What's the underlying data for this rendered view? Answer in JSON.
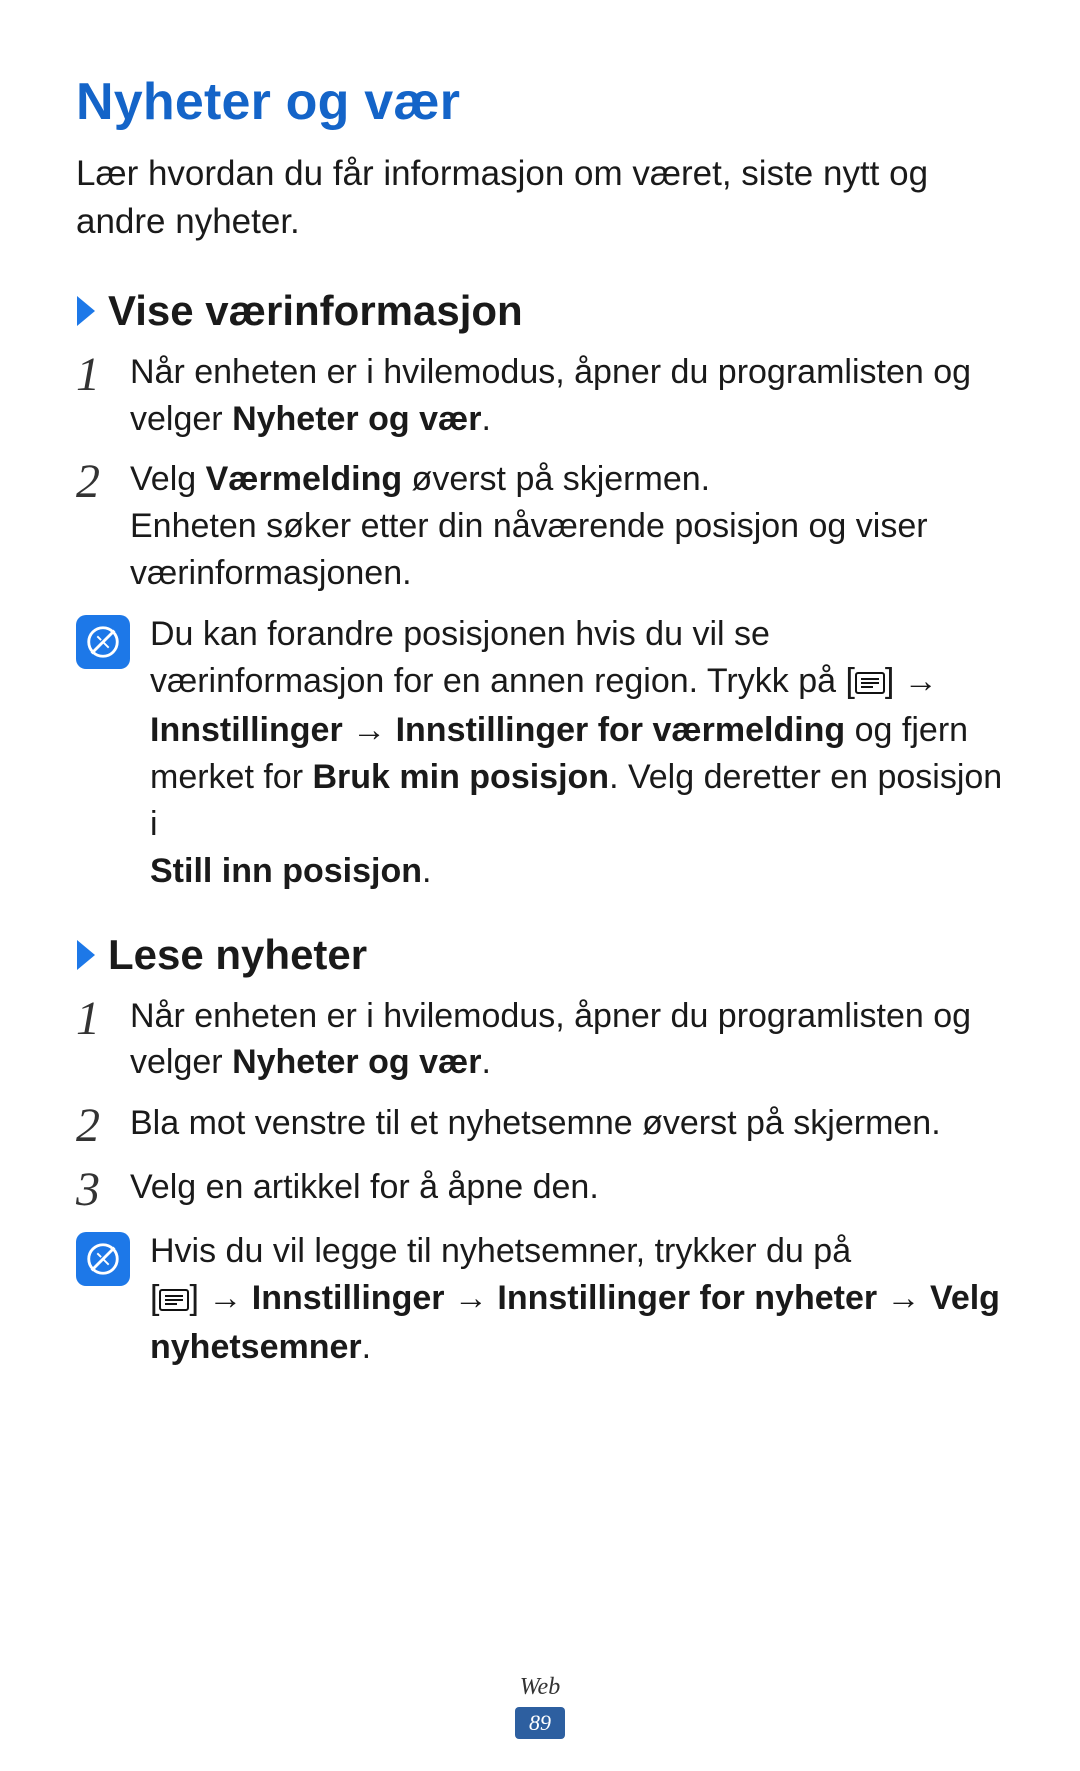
{
  "title": "Nyheter og vær",
  "intro": "Lær hvordan du får informasjon om været, siste nytt og andre nyheter.",
  "section1": {
    "heading": "Vise værinformasjon",
    "step1_a": "Når enheten er i hvilemodus, åpner du programlisten og velger ",
    "step1_b": "Nyheter og vær",
    "step1_c": ".",
    "step2_a": "Velg ",
    "step2_b": "Værmelding",
    "step2_c": " øverst på skjermen.",
    "step2_d": "Enheten søker etter din nåværende posisjon og viser værinformasjonen.",
    "note_a": "Du kan forandre posisjonen hvis du vil se værinformasjon for en annen region. Trykk på [",
    "note_b": "] → ",
    "note_c": "Innstillinger",
    "note_d": " → ",
    "note_e": "Innstillinger for værmelding",
    "note_f": " og fjern merket for ",
    "note_g": "Bruk min posisjon",
    "note_h": ". Velg deretter en posisjon i ",
    "note_i": "Still inn posisjon",
    "note_j": "."
  },
  "section2": {
    "heading": "Lese nyheter",
    "step1_a": "Når enheten er i hvilemodus, åpner du programlisten og velger ",
    "step1_b": "Nyheter og vær",
    "step1_c": ".",
    "step2": "Bla mot venstre til et nyhetsemne øverst på skjermen.",
    "step3": "Velg en artikkel for å åpne den.",
    "note_a": "Hvis du vil legge til nyhetsemner, trykker du på ",
    "note_b": "[",
    "note_c": "] → ",
    "note_d": "Innstillinger",
    "note_e": " → ",
    "note_f": "Innstillinger for nyheter",
    "note_g": " → ",
    "note_h": "Velg nyhetsemner",
    "note_i": "."
  },
  "nums": {
    "n1": "1",
    "n2": "2",
    "n3": "3"
  },
  "footer": {
    "category": "Web",
    "page": "89"
  }
}
